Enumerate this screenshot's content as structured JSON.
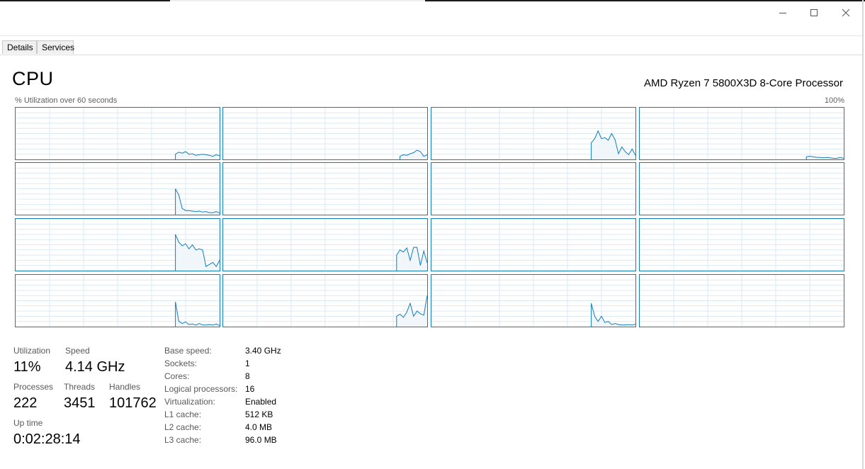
{
  "tabs": [
    {
      "label": "Details"
    },
    {
      "label": "Services"
    }
  ],
  "header": {
    "title": "CPU",
    "processor": "AMD Ryzen 7 5800X3D 8-Core Processor",
    "graph_caption": "% Utilization over 60 seconds",
    "graph_max": "100%"
  },
  "colors": {
    "graph_line": "#117dbb",
    "graph_fill": "#f1f6fa",
    "grid_line": "#d9eaf4"
  },
  "cores_utilization": [
    [
      0,
      0,
      0,
      0,
      0,
      0,
      0,
      0,
      0,
      0,
      0,
      0,
      0,
      0,
      0,
      0,
      0,
      0,
      0,
      0,
      0,
      0,
      0,
      0,
      0,
      0,
      0,
      0,
      0,
      0,
      0,
      0,
      0,
      0,
      0,
      0,
      0,
      0,
      0,
      0,
      0,
      0,
      0,
      0,
      0,
      0,
      0,
      10,
      14,
      12,
      15,
      10,
      11,
      8,
      9,
      10,
      9,
      8,
      6,
      9,
      7
    ],
    [
      0,
      0,
      0,
      0,
      0,
      0,
      0,
      0,
      0,
      0,
      0,
      0,
      0,
      0,
      0,
      0,
      0,
      0,
      0,
      0,
      0,
      0,
      0,
      0,
      0,
      0,
      0,
      0,
      0,
      0,
      0,
      0,
      0,
      0,
      0,
      0,
      0,
      0,
      0,
      0,
      0,
      0,
      0,
      0,
      0,
      0,
      0,
      0,
      0,
      0,
      0,
      0,
      6,
      9,
      8,
      11,
      13,
      18,
      15,
      6,
      9
    ],
    [
      0,
      0,
      0,
      0,
      0,
      0,
      0,
      0,
      0,
      0,
      0,
      0,
      0,
      0,
      0,
      0,
      0,
      0,
      0,
      0,
      0,
      0,
      0,
      0,
      0,
      0,
      0,
      0,
      0,
      0,
      0,
      0,
      0,
      0,
      0,
      0,
      0,
      0,
      0,
      0,
      0,
      0,
      0,
      0,
      0,
      0,
      0,
      32,
      40,
      55,
      40,
      42,
      37,
      50,
      38,
      11,
      24,
      15,
      9,
      20,
      8
    ],
    [
      0,
      0,
      0,
      0,
      0,
      0,
      0,
      0,
      0,
      0,
      0,
      0,
      0,
      0,
      0,
      0,
      0,
      0,
      0,
      0,
      0,
      0,
      0,
      0,
      0,
      0,
      0,
      0,
      0,
      0,
      0,
      0,
      0,
      0,
      0,
      0,
      0,
      0,
      0,
      0,
      0,
      0,
      0,
      0,
      0,
      0,
      0,
      0,
      0,
      5,
      6,
      5,
      4,
      4,
      3,
      4,
      3,
      2,
      2,
      4,
      2
    ],
    [
      0,
      0,
      0,
      0,
      0,
      0,
      0,
      0,
      0,
      0,
      0,
      0,
      0,
      0,
      0,
      0,
      0,
      0,
      0,
      0,
      0,
      0,
      0,
      0,
      0,
      0,
      0,
      0,
      0,
      0,
      0,
      0,
      0,
      0,
      0,
      0,
      0,
      0,
      0,
      0,
      0,
      0,
      0,
      0,
      0,
      0,
      0,
      50,
      38,
      12,
      8,
      8,
      7,
      6,
      7,
      5,
      6,
      4,
      4,
      6,
      3
    ],
    [
      0,
      0,
      0,
      0,
      0,
      0,
      0,
      0,
      0,
      0,
      0,
      0,
      0,
      0,
      0,
      0,
      0,
      0,
      0,
      0,
      0,
      0,
      0,
      0,
      0,
      0,
      0,
      0,
      0,
      0,
      0,
      0,
      0,
      0,
      0,
      0,
      0,
      0,
      0,
      0,
      0,
      0,
      0,
      0,
      0,
      0,
      0,
      0,
      0,
      0,
      0,
      0,
      0,
      0,
      0,
      0,
      0,
      0,
      0,
      0,
      0
    ],
    [
      0,
      0,
      0,
      0,
      0,
      0,
      0,
      0,
      0,
      0,
      0,
      0,
      0,
      0,
      0,
      0,
      0,
      0,
      0,
      0,
      0,
      0,
      0,
      0,
      0,
      0,
      0,
      0,
      0,
      0,
      0,
      0,
      0,
      0,
      0,
      0,
      0,
      0,
      0,
      0,
      0,
      0,
      0,
      0,
      0,
      0,
      0,
      0,
      0,
      0,
      0,
      0,
      0,
      0,
      0,
      0,
      0,
      0,
      0,
      0,
      0
    ],
    [
      0,
      0,
      0,
      0,
      0,
      0,
      0,
      0,
      0,
      0,
      0,
      0,
      0,
      0,
      0,
      0,
      0,
      0,
      0,
      0,
      0,
      0,
      0,
      0,
      0,
      0,
      0,
      0,
      0,
      0,
      0,
      0,
      0,
      0,
      0,
      0,
      0,
      0,
      0,
      0,
      0,
      0,
      0,
      0,
      0,
      0,
      0,
      0,
      0,
      0,
      0,
      0,
      0,
      0,
      0,
      0,
      0,
      0,
      0,
      0,
      0
    ],
    [
      0,
      0,
      0,
      0,
      0,
      0,
      0,
      0,
      0,
      0,
      0,
      0,
      0,
      0,
      0,
      0,
      0,
      0,
      0,
      0,
      0,
      0,
      0,
      0,
      0,
      0,
      0,
      0,
      0,
      0,
      0,
      0,
      0,
      0,
      0,
      0,
      0,
      0,
      0,
      0,
      0,
      0,
      0,
      0,
      0,
      0,
      0,
      70,
      55,
      48,
      52,
      42,
      50,
      40,
      42,
      40,
      8,
      12,
      16,
      8,
      20
    ],
    [
      0,
      0,
      0,
      0,
      0,
      0,
      0,
      0,
      0,
      0,
      0,
      0,
      0,
      0,
      0,
      0,
      0,
      0,
      0,
      0,
      0,
      0,
      0,
      0,
      0,
      0,
      0,
      0,
      0,
      0,
      0,
      0,
      0,
      0,
      0,
      0,
      0,
      0,
      0,
      0,
      0,
      0,
      0,
      0,
      0,
      0,
      0,
      0,
      0,
      0,
      0,
      30,
      40,
      36,
      44,
      20,
      45,
      45,
      10,
      38,
      15
    ],
    [
      0,
      0,
      0,
      0,
      0,
      0,
      0,
      0,
      0,
      0,
      0,
      0,
      0,
      0,
      0,
      0,
      0,
      0,
      0,
      0,
      0,
      0,
      0,
      0,
      0,
      0,
      0,
      0,
      0,
      0,
      0,
      0,
      0,
      0,
      0,
      0,
      0,
      0,
      0,
      0,
      0,
      0,
      0,
      0,
      0,
      0,
      0,
      0,
      0,
      0,
      0,
      0,
      0,
      0,
      0,
      0,
      0,
      0,
      0,
      0,
      0
    ],
    [
      0,
      0,
      0,
      0,
      0,
      0,
      0,
      0,
      0,
      0,
      0,
      0,
      0,
      0,
      0,
      0,
      0,
      0,
      0,
      0,
      0,
      0,
      0,
      0,
      0,
      0,
      0,
      0,
      0,
      0,
      0,
      0,
      0,
      0,
      0,
      0,
      0,
      0,
      0,
      0,
      0,
      0,
      0,
      0,
      0,
      0,
      0,
      0,
      0,
      0,
      0,
      0,
      0,
      0,
      0,
      0,
      0,
      0,
      0,
      0,
      0
    ],
    [
      0,
      0,
      0,
      0,
      0,
      0,
      0,
      0,
      0,
      0,
      0,
      0,
      0,
      0,
      0,
      0,
      0,
      0,
      0,
      0,
      0,
      0,
      0,
      0,
      0,
      0,
      0,
      0,
      0,
      0,
      0,
      0,
      0,
      0,
      0,
      0,
      0,
      0,
      0,
      0,
      0,
      0,
      0,
      0,
      0,
      0,
      0,
      48,
      10,
      6,
      9,
      4,
      5,
      3,
      6,
      3,
      3,
      4,
      3,
      5,
      2
    ],
    [
      0,
      0,
      0,
      0,
      0,
      0,
      0,
      0,
      0,
      0,
      0,
      0,
      0,
      0,
      0,
      0,
      0,
      0,
      0,
      0,
      0,
      0,
      0,
      0,
      0,
      0,
      0,
      0,
      0,
      0,
      0,
      0,
      0,
      0,
      0,
      0,
      0,
      0,
      0,
      0,
      0,
      0,
      0,
      0,
      0,
      0,
      0,
      0,
      0,
      0,
      0,
      20,
      24,
      18,
      28,
      45,
      20,
      30,
      25,
      22,
      60
    ],
    [
      0,
      0,
      0,
      0,
      0,
      0,
      0,
      0,
      0,
      0,
      0,
      0,
      0,
      0,
      0,
      0,
      0,
      0,
      0,
      0,
      0,
      0,
      0,
      0,
      0,
      0,
      0,
      0,
      0,
      0,
      0,
      0,
      0,
      0,
      0,
      0,
      0,
      0,
      0,
      0,
      0,
      0,
      0,
      0,
      0,
      0,
      0,
      45,
      20,
      10,
      20,
      8,
      10,
      4,
      6,
      4,
      3,
      3,
      4,
      3,
      5
    ],
    [
      0,
      0,
      0,
      0,
      0,
      0,
      0,
      0,
      0,
      0,
      0,
      0,
      0,
      0,
      0,
      0,
      0,
      0,
      0,
      0,
      0,
      0,
      0,
      0,
      0,
      0,
      0,
      0,
      0,
      0,
      0,
      0,
      0,
      0,
      0,
      0,
      0,
      0,
      0,
      0,
      0,
      0,
      0,
      0,
      0,
      0,
      0,
      0,
      0,
      0,
      0,
      0,
      0,
      0,
      0,
      0,
      0,
      0,
      0,
      0,
      0
    ]
  ],
  "stats": {
    "utilization": {
      "label": "Utilization",
      "value": "11%"
    },
    "speed": {
      "label": "Speed",
      "value": "4.14 GHz"
    },
    "processes": {
      "label": "Processes",
      "value": "222"
    },
    "threads": {
      "label": "Threads",
      "value": "3451"
    },
    "handles": {
      "label": "Handles",
      "value": "101762"
    },
    "uptime": {
      "label": "Up time",
      "value": "0:02:28:14"
    }
  },
  "specs": [
    {
      "label": "Base speed:",
      "value": "3.40 GHz"
    },
    {
      "label": "Sockets:",
      "value": "1"
    },
    {
      "label": "Cores:",
      "value": "8"
    },
    {
      "label": "Logical processors:",
      "value": "16"
    },
    {
      "label": "Virtualization:",
      "value": "Enabled"
    },
    {
      "label": "L1 cache:",
      "value": "512 KB"
    },
    {
      "label": "L2 cache:",
      "value": "4.0 MB"
    },
    {
      "label": "L3 cache:",
      "value": "96.0 MB"
    }
  ]
}
